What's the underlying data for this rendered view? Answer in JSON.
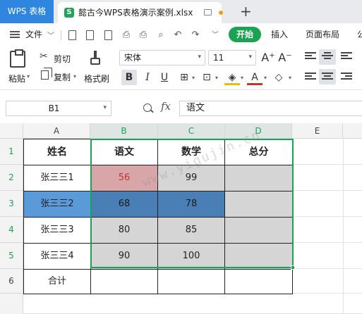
{
  "titlebar": {
    "app_name": "WPS 表格",
    "file_icon": "S",
    "file_name": "懿古今WPS表格演示案例.xlsx"
  },
  "menu": {
    "file_label": "文件",
    "tabs": [
      "开始",
      "插入",
      "页面布局",
      "公"
    ]
  },
  "ribbon": {
    "paste_label": "粘贴",
    "cut_label": "剪切",
    "copy_label": "复制",
    "format_painter_label": "格式刷",
    "font_name": "宋体",
    "font_size": "11",
    "bold": "B",
    "italic": "I",
    "underline": "U",
    "font_grow": "A⁺",
    "font_shrink": "A⁻"
  },
  "formula_bar": {
    "cell_ref": "B1",
    "fx_label": "fx",
    "content": "语文"
  },
  "sheet": {
    "columns": [
      "A",
      "B",
      "C",
      "D",
      "E"
    ],
    "rows": [
      "1",
      "2",
      "3",
      "4",
      "5",
      "6"
    ],
    "header": [
      "姓名",
      "语文",
      "数学",
      "总分"
    ],
    "data": [
      [
        "张三三1",
        "56",
        "99",
        ""
      ],
      [
        "张三三2",
        "68",
        "78",
        ""
      ],
      [
        "张三三3",
        "80",
        "85",
        ""
      ],
      [
        "张三三4",
        "90",
        "100",
        ""
      ],
      [
        "合计",
        "",
        "",
        ""
      ]
    ],
    "highlight_colors": {
      "pink": "#d8a5a8",
      "blue": "#4a7fb5",
      "name_blue": "#5a9ad8",
      "gray": "#d5d5d5",
      "selection_green": "#1ba354"
    }
  },
  "watermark": "www.yigujin.cn"
}
